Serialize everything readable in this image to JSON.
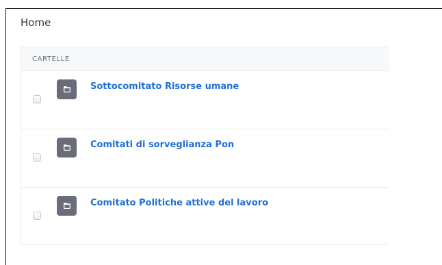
{
  "breadcrumb": {
    "home": "Home"
  },
  "panel": {
    "header": "CARTELLE",
    "folders": [
      {
        "title": "Sottocomitato Risorse umane",
        "icon": "folder-icon"
      },
      {
        "title": "Comitati di sorveglianza Pon",
        "icon": "folder-icon"
      },
      {
        "title": "Comitato Politiche attive del lavoro",
        "icon": "folder-icon"
      }
    ]
  },
  "colors": {
    "link": "#1f6fd8",
    "tile": "#6a6c79"
  }
}
